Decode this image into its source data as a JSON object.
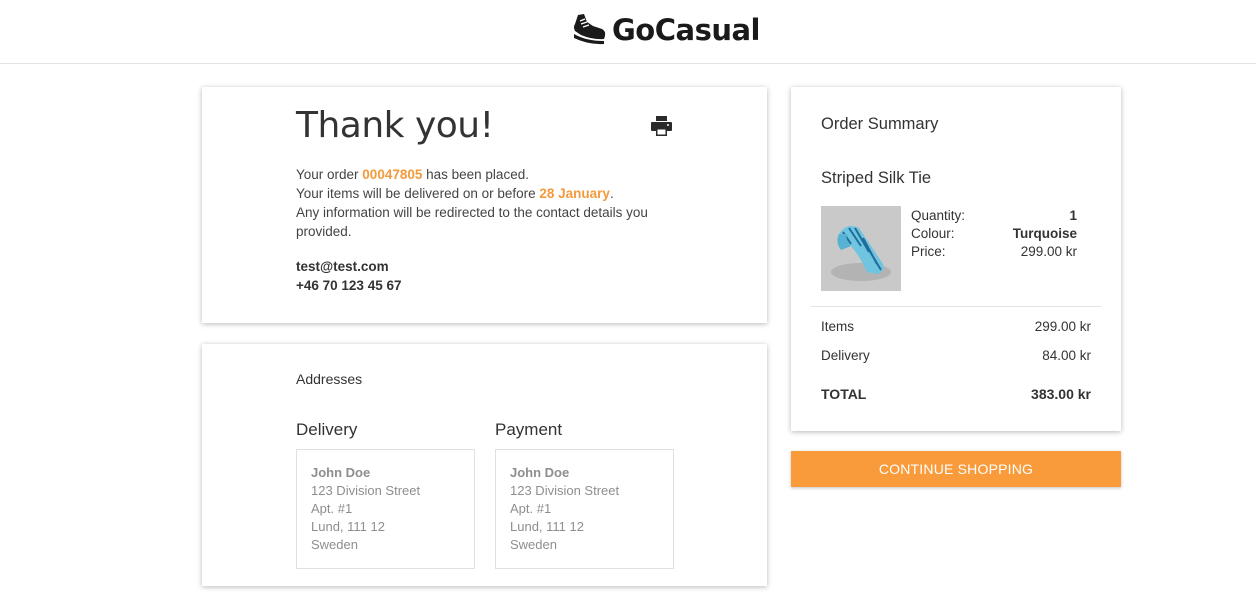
{
  "brand": {
    "name": "GoCasual",
    "logo_icon": "sneaker-icon"
  },
  "confirmation": {
    "title": "Thank you!",
    "print_icon": "printer-icon",
    "line1_prefix": "Your order ",
    "order_number": "00047805",
    "line1_suffix": " has been placed.",
    "line2_prefix": "Your items will be delivered on or before ",
    "delivery_date": "28 January",
    "line2_suffix": ".",
    "line3": "Any information will be redirected to the contact details you provided.",
    "email": "test@test.com",
    "phone": "+46 70 123 45 67"
  },
  "addresses": {
    "heading": "Addresses",
    "delivery": {
      "title": "Delivery",
      "name": "John Doe",
      "street": "123 Division Street",
      "apt": "Apt. #1",
      "city": "Lund, 111 12",
      "country": "Sweden"
    },
    "payment": {
      "title": "Payment",
      "name": "John Doe",
      "street": "123 Division Street",
      "apt": "Apt. #1",
      "city": "Lund, 111 12",
      "country": "Sweden"
    }
  },
  "summary": {
    "title": "Order Summary",
    "product": {
      "name": "Striped Silk Tie",
      "quantity_label": "Quantity:",
      "quantity": "1",
      "colour_label": "Colour:",
      "colour": "Turquoise",
      "price_label": "Price:",
      "price": "299.00 kr"
    },
    "items_label": "Items",
    "items_value": "299.00 kr",
    "delivery_label": "Delivery",
    "delivery_value": "84.00 kr",
    "total_label": "TOTAL",
    "total_value": "383.00 kr"
  },
  "actions": {
    "continue_label": "CONTINUE SHOPPING"
  },
  "colors": {
    "accent": "#f99b3a",
    "highlight": "#f39a3d"
  }
}
